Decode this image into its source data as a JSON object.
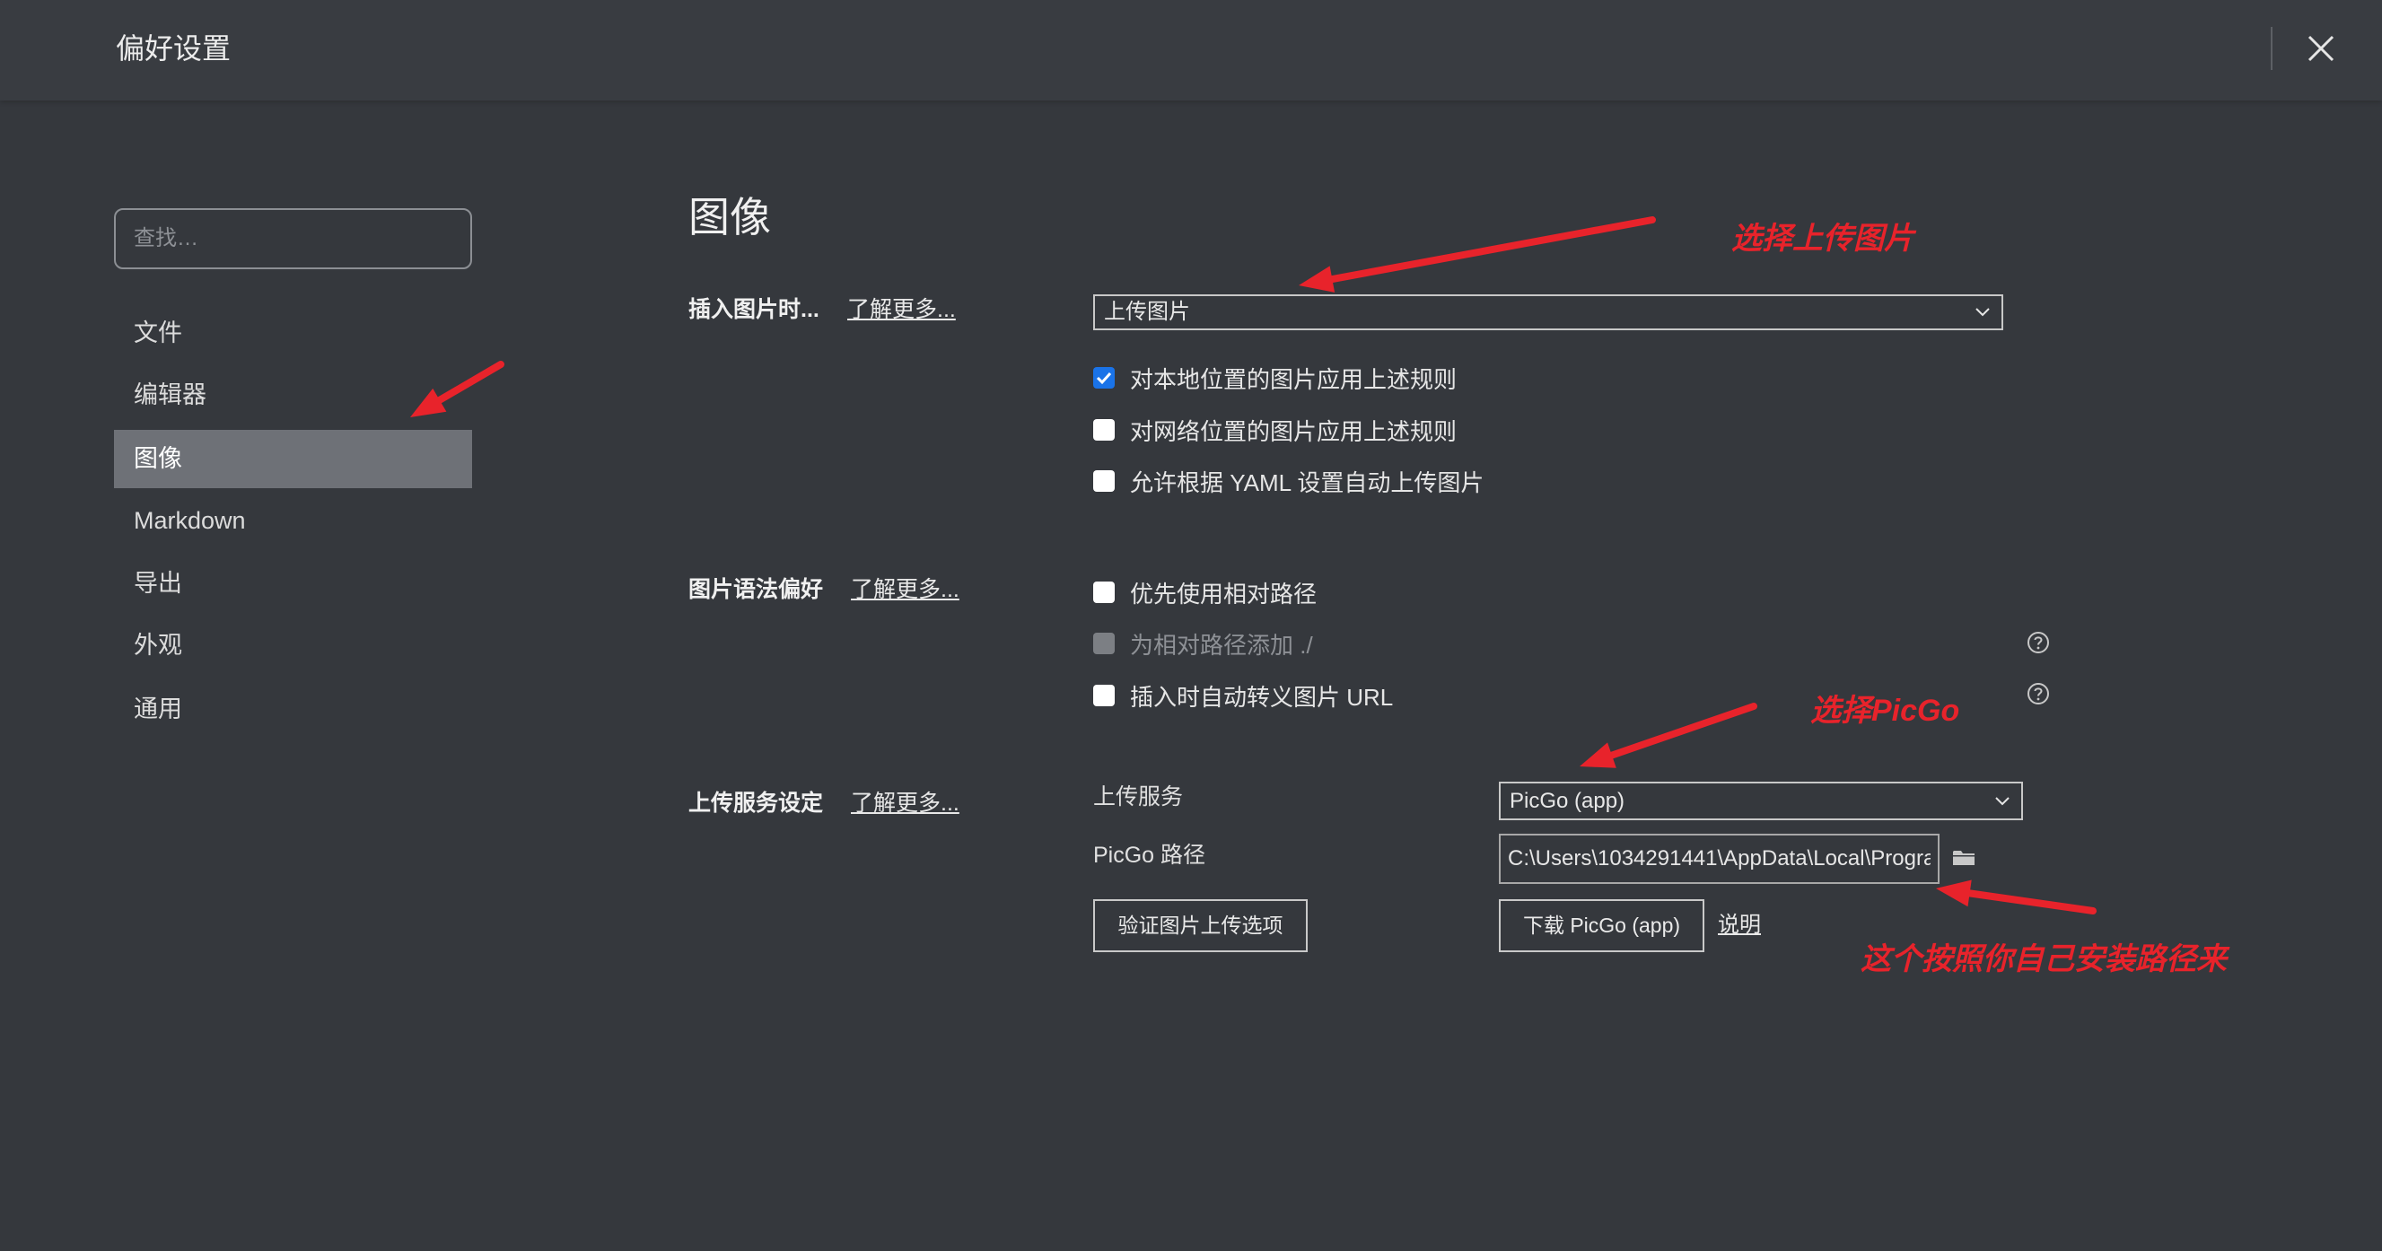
{
  "window": {
    "title": "偏好设置"
  },
  "search": {
    "placeholder": "查找…"
  },
  "sidebar": {
    "items": [
      {
        "label": "文件",
        "selected": false
      },
      {
        "label": "编辑器",
        "selected": false
      },
      {
        "label": "图像",
        "selected": true
      },
      {
        "label": "Markdown",
        "selected": false
      },
      {
        "label": "导出",
        "selected": false
      },
      {
        "label": "外观",
        "selected": false
      },
      {
        "label": "通用",
        "selected": false
      }
    ]
  },
  "content": {
    "title": "图像",
    "insert_image": {
      "label": "插入图片时...",
      "learn_more": "了解更多...",
      "action": "上传图片",
      "options": [
        {
          "label": "对本地位置的图片应用上述规则",
          "checked": true,
          "disabled": false
        },
        {
          "label": "对网络位置的图片应用上述规则",
          "checked": false,
          "disabled": false
        },
        {
          "label": "允许根据 YAML 设置自动上传图片",
          "checked": false,
          "disabled": false
        }
      ]
    },
    "syntax_preference": {
      "label": "图片语法偏好",
      "learn_more": "了解更多...",
      "options": [
        {
          "label": "优先使用相对路径",
          "checked": false,
          "disabled": false
        },
        {
          "label": "为相对路径添加 ./",
          "checked": false,
          "disabled": true
        },
        {
          "label": "插入时自动转义图片 URL",
          "checked": false,
          "disabled": false
        }
      ]
    },
    "upload_service": {
      "label": "上传服务设定",
      "learn_more": "了解更多...",
      "service_label": "上传服务",
      "service_value": "PicGo (app)",
      "path_label": "PicGo 路径",
      "path_value": "C:\\Users\\1034291441\\AppData\\Local\\Progra",
      "verify_button": "验证图片上传选项",
      "download_button": "下载 PicGo (app)",
      "help_link": "说明"
    }
  },
  "annotations": [
    {
      "text": "选择上传图片"
    },
    {
      "text": "选择PicGo"
    },
    {
      "text": "这个按照你自己安装路径来"
    }
  ],
  "icons": [
    "close-icon",
    "chevron-down-icon",
    "check-icon",
    "help-icon",
    "folder-icon"
  ],
  "colors": {
    "background": "#35383d",
    "header": "#393c41",
    "selected": "#6e7177",
    "accent": "#1a73e8",
    "annotation": "#e8232b"
  }
}
